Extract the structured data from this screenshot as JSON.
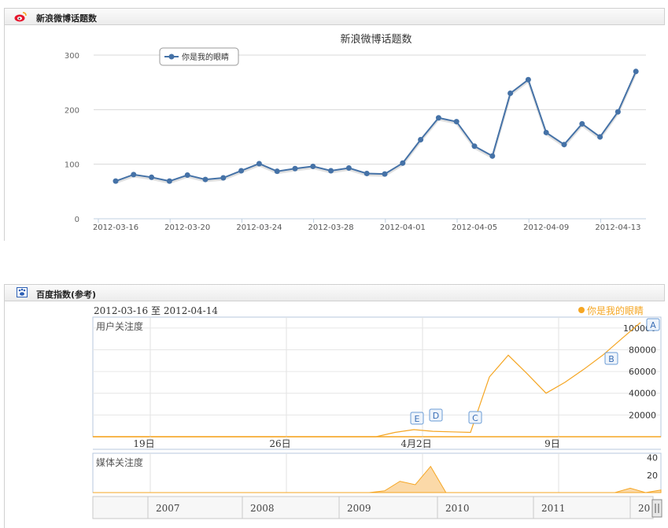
{
  "weibo_panel": {
    "header_title": "新浪微博话题数",
    "icon": "weibo-icon"
  },
  "baidu_panel": {
    "header_title": "百度指数(参考)",
    "icon": "baidu-paw-icon",
    "date_range": "2012-03-16 至 2012-04-14",
    "legend": "你是我的眼睛",
    "user_label": "用户关注度",
    "media_label": "媒体关注度",
    "user_yticks": [
      "100000",
      "80000",
      "60000",
      "40000",
      "20000"
    ],
    "media_yticks": [
      "40",
      "20"
    ],
    "x_labels": [
      "19日",
      "26日",
      "4月2日",
      "9日"
    ],
    "markers": [
      "A",
      "B",
      "C",
      "D",
      "E"
    ],
    "timeline_years": [
      "2007",
      "2008",
      "2009",
      "2010",
      "2011",
      "20"
    ],
    "accent_color": "#f5a623"
  },
  "chart_data": [
    {
      "type": "line",
      "title": "新浪微博话题数",
      "legend": "你是我的眼睛",
      "xlabel": "",
      "ylabel": "",
      "ylim": [
        0,
        300
      ],
      "yticks": [
        0,
        100,
        200,
        300
      ],
      "xticks": [
        "2012-03-16",
        "2012-03-20",
        "2012-03-24",
        "2012-03-28",
        "2012-04-01",
        "2012-04-05",
        "2012-04-09",
        "2012-04-13"
      ],
      "grid": true,
      "legend_position": "top-left",
      "color": "#4572a7",
      "series": [
        {
          "name": "你是我的眼睛",
          "x": [
            "2012-03-16",
            "2012-03-17",
            "2012-03-18",
            "2012-03-19",
            "2012-03-20",
            "2012-03-21",
            "2012-03-22",
            "2012-03-23",
            "2012-03-24",
            "2012-03-25",
            "2012-03-26",
            "2012-03-27",
            "2012-03-28",
            "2012-03-29",
            "2012-03-30",
            "2012-03-31",
            "2012-04-01",
            "2012-04-02",
            "2012-04-03",
            "2012-04-04",
            "2012-04-05",
            "2012-04-06",
            "2012-04-07",
            "2012-04-08",
            "2012-04-09",
            "2012-04-10",
            "2012-04-11",
            "2012-04-12",
            "2012-04-13",
            "2012-04-14"
          ],
          "values": [
            69,
            81,
            76,
            69,
            80,
            72,
            75,
            88,
            101,
            87,
            92,
            96,
            88,
            93,
            83,
            82,
            102,
            145,
            185,
            178,
            133,
            115,
            230,
            255,
            158,
            136,
            174,
            150,
            196,
            270
          ]
        }
      ]
    },
    {
      "type": "line",
      "title": "",
      "legend": "你是我的眼睛",
      "ylabel": "用户关注度",
      "ylim": [
        0,
        110000
      ],
      "color": "#f5a623",
      "series": [
        {
          "name": "你是我的眼睛",
          "x": [
            "2012-03-16",
            "2012-03-17",
            "2012-03-18",
            "2012-03-19",
            "2012-03-20",
            "2012-03-21",
            "2012-03-22",
            "2012-03-23",
            "2012-03-24",
            "2012-03-25",
            "2012-03-26",
            "2012-03-27",
            "2012-03-28",
            "2012-03-29",
            "2012-03-30",
            "2012-03-31",
            "2012-04-01",
            "2012-04-02",
            "2012-04-03",
            "2012-04-04",
            "2012-04-05",
            "2012-04-06",
            "2012-04-07",
            "2012-04-08",
            "2012-04-09",
            "2012-04-10",
            "2012-04-11",
            "2012-04-12",
            "2012-04-13",
            "2012-04-14"
          ],
          "values": [
            0,
            0,
            0,
            0,
            0,
            0,
            0,
            0,
            0,
            0,
            0,
            0,
            0,
            0,
            0,
            0,
            4000,
            6500,
            5000,
            4500,
            4000,
            55000,
            75000,
            58000,
            40000,
            50000,
            62000,
            75000,
            90000,
            105000
          ]
        }
      ]
    },
    {
      "type": "area",
      "title": "",
      "ylabel": "媒体关注度",
      "ylim": [
        0,
        45
      ],
      "color": "#f5a623",
      "series": [
        {
          "name": "你是我的眼睛",
          "values": [
            0,
            0,
            0,
            0,
            0,
            0,
            0,
            0,
            0,
            0,
            0,
            0,
            0,
            0,
            0,
            0,
            0,
            0,
            0,
            2,
            13,
            9,
            30,
            0,
            0,
            0,
            0,
            0,
            0,
            0,
            0,
            0,
            0,
            0,
            0,
            5,
            0,
            3
          ]
        }
      ]
    }
  ]
}
